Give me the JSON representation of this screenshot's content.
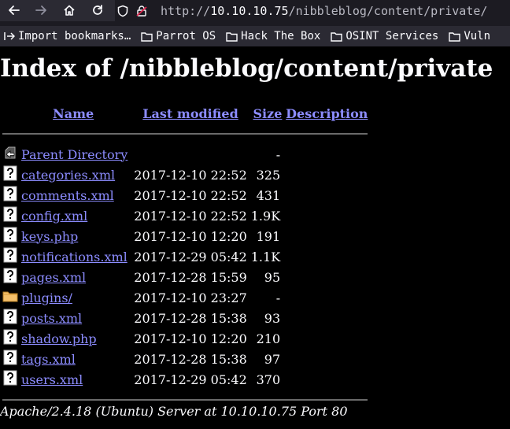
{
  "browser": {
    "url_scheme": "http://",
    "url_host": "10.10.10.75",
    "url_path": "/nibbleblog/content/private/",
    "bookmarks": [
      {
        "label": "Import bookmarks…",
        "icon": "import-icon"
      },
      {
        "label": "Parrot OS",
        "icon": "folder-icon"
      },
      {
        "label": "Hack The Box",
        "icon": "folder-icon"
      },
      {
        "label": "OSINT Services",
        "icon": "folder-icon"
      },
      {
        "label": "Vuln",
        "icon": "folder-icon"
      }
    ]
  },
  "page": {
    "title": "Index of /nibbleblog/content/private",
    "columns": {
      "name": "Name",
      "modified": "Last modified",
      "size": "Size",
      "description": "Description"
    },
    "rows": [
      {
        "name": "Parent Directory",
        "modified": "",
        "size": "-",
        "icon": "parent-directory-icon"
      },
      {
        "name": "categories.xml",
        "modified": "2017-12-10 22:52",
        "size": "325",
        "icon": "file-icon"
      },
      {
        "name": "comments.xml",
        "modified": "2017-12-10 22:52",
        "size": "431",
        "icon": "file-icon"
      },
      {
        "name": "config.xml",
        "modified": "2017-12-10 22:52",
        "size": "1.9K",
        "icon": "file-icon"
      },
      {
        "name": "keys.php",
        "modified": "2017-12-10 12:20",
        "size": "191",
        "icon": "file-icon"
      },
      {
        "name": "notifications.xml",
        "modified": "2017-12-29 05:42",
        "size": "1.1K",
        "icon": "file-icon"
      },
      {
        "name": "pages.xml",
        "modified": "2017-12-28 15:59",
        "size": "95",
        "icon": "file-icon"
      },
      {
        "name": "plugins/",
        "modified": "2017-12-10 23:27",
        "size": "-",
        "icon": "folder-icon"
      },
      {
        "name": "posts.xml",
        "modified": "2017-12-28 15:38",
        "size": "93",
        "icon": "file-icon"
      },
      {
        "name": "shadow.php",
        "modified": "2017-12-10 12:20",
        "size": "210",
        "icon": "file-icon"
      },
      {
        "name": "tags.xml",
        "modified": "2017-12-28 15:38",
        "size": "97",
        "icon": "file-icon"
      },
      {
        "name": "users.xml",
        "modified": "2017-12-29 05:42",
        "size": "370",
        "icon": "file-icon"
      }
    ],
    "footer": "Apache/2.4.18 (Ubuntu) Server at 10.10.10.75 Port 80"
  },
  "colors": {
    "link": "#8c8cff",
    "background": "#000000",
    "chrome": "#2b2a33"
  }
}
